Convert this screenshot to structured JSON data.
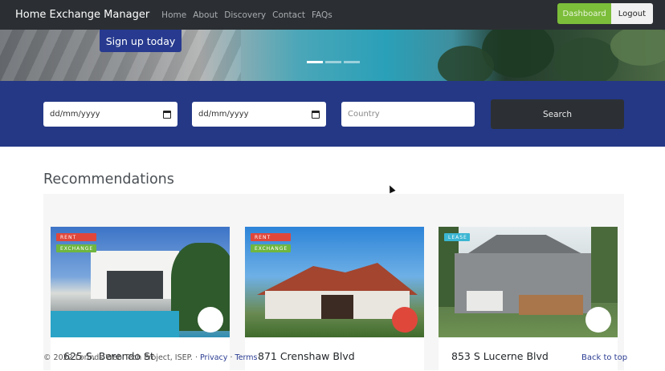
{
  "navbar": {
    "brand": "Home Exchange Manager",
    "links": [
      "Home",
      "About",
      "Discovery",
      "Contact",
      "FAQs"
    ],
    "dashboard_label": "Dashboard",
    "logout_label": "Logout"
  },
  "hero": {
    "signup_label": "Sign up today",
    "slides": 3,
    "active_slide": 1
  },
  "search": {
    "checkin_value": "dd/mm/yyyy",
    "checkout_value": "dd/mm/yyyy",
    "country_placeholder": "Country",
    "search_label": "Search"
  },
  "recommendations": {
    "title": "Recommendations",
    "cards": [
      {
        "title": "625 S. Berendo St",
        "badges": [
          "RENT",
          "EXCHANGE"
        ],
        "favorited": false
      },
      {
        "title": "871 Crenshaw Blvd",
        "badges": [
          "RENT",
          "EXCHANGE"
        ],
        "favorited": true
      },
      {
        "title": "853 S Lucerne Blvd",
        "badges": [
          "LEASE"
        ],
        "favorited": false
      }
    ]
  },
  "footer": {
    "copyright": "© 2022 Lorinds Web Tech Project, ISEP.",
    "sep": "·",
    "privacy": "Privacy",
    "terms": "Terms",
    "back_to_top": "Back to top"
  },
  "colors": {
    "navbar": "#2b2f33",
    "primary": "#243886",
    "dashboard": "#7cbd3a",
    "rent": "#e0473b",
    "exchange": "#6fb640",
    "lease": "#3bb6d3"
  }
}
